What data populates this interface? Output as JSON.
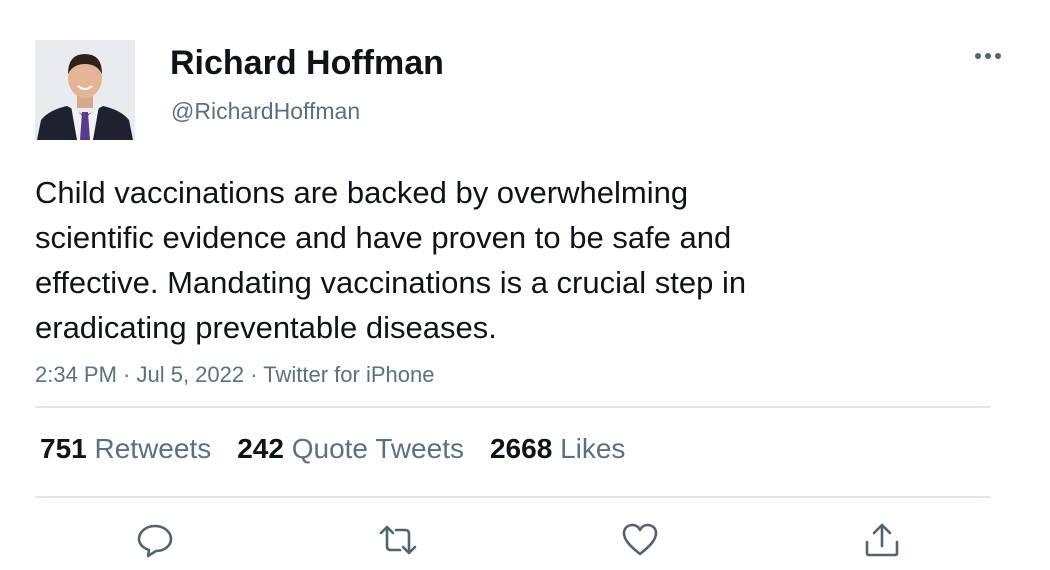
{
  "author": {
    "display_name": "Richard Hoffman",
    "handle": "@RichardHoffman",
    "avatar_icon": "profile-photo"
  },
  "tweet": {
    "text": "Child vaccinations are backed by overwhelming\nscientific evidence and have proven to be safe and\neffective. Mandating vaccinations is a crucial step in\neradicating preventable diseases.",
    "meta": "2:34 PM · Jul 5, 2022 · Twitter for iPhone"
  },
  "stats": {
    "retweets": {
      "count": "751",
      "label": "Retweets"
    },
    "quotes": {
      "count": "242",
      "label": "Quote Tweets"
    },
    "likes": {
      "count": "2668",
      "label": "Likes"
    }
  },
  "actions": {
    "reply_icon": "reply-icon",
    "retweet_icon": "retweet-icon",
    "like_icon": "heart-icon",
    "share_icon": "share-icon",
    "more_icon": "more-icon"
  },
  "colors": {
    "text_primary": "#0f1419",
    "text_secondary": "#5b7083",
    "divider": "#e1e4e8",
    "icon": "#536471"
  }
}
